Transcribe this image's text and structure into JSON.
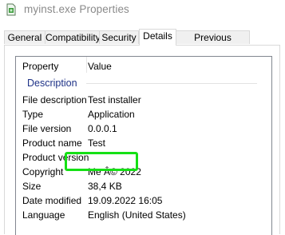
{
  "window": {
    "title": "myinst.exe Properties",
    "icon": "installer-file-icon"
  },
  "tabs": [
    {
      "label": "General",
      "active": false
    },
    {
      "label": "Compatibility",
      "active": false
    },
    {
      "label": "Security",
      "active": false
    },
    {
      "label": "Details",
      "active": true
    },
    {
      "label": "Previous Versions",
      "active": false
    }
  ],
  "details": {
    "columns": {
      "property": "Property",
      "value": "Value"
    },
    "group": "Description",
    "rows": [
      {
        "label": "File description",
        "value": "Test installer"
      },
      {
        "label": "Type",
        "value": "Application"
      },
      {
        "label": "File version",
        "value": "0.0.0.1"
      },
      {
        "label": "Product name",
        "value": "Test"
      },
      {
        "label": "Product version",
        "value": ""
      },
      {
        "label": "Copyright",
        "value": "Me Â© 2022"
      },
      {
        "label": "Size",
        "value": "38,4 KB"
      },
      {
        "label": "Date modified",
        "value": "19.09.2022 16:05"
      },
      {
        "label": "Language",
        "value": "English (United States)"
      }
    ]
  },
  "highlight": {
    "target": "Copyright",
    "color": "#15e015"
  },
  "colors": {
    "group_heading": "#1e3287"
  }
}
